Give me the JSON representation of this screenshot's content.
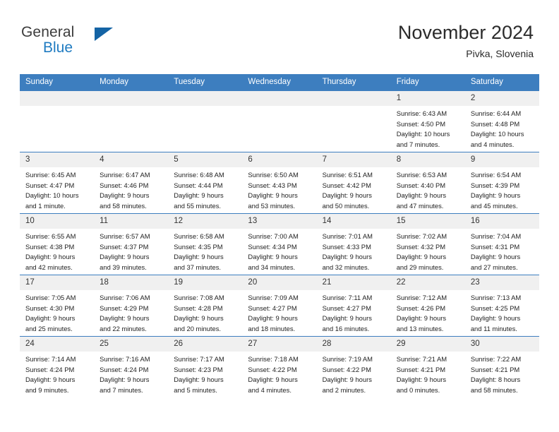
{
  "brand": {
    "name_part1": "General",
    "name_part2": "Blue",
    "triangle_color": "#1464a5",
    "blue_color": "#1f7bc1"
  },
  "header": {
    "title": "November 2024",
    "subtitle": "Pivka, Slovenia",
    "header_bg": "#3d7ebf",
    "header_text": "#ffffff",
    "daynum_bg": "#f0f0f0"
  },
  "weekday_headers": [
    "Sunday",
    "Monday",
    "Tuesday",
    "Wednesday",
    "Thursday",
    "Friday",
    "Saturday"
  ],
  "weeks": [
    [
      {
        "day": "",
        "sunrise": "",
        "sunset": "",
        "daylight1": "",
        "daylight2": ""
      },
      {
        "day": "",
        "sunrise": "",
        "sunset": "",
        "daylight1": "",
        "daylight2": ""
      },
      {
        "day": "",
        "sunrise": "",
        "sunset": "",
        "daylight1": "",
        "daylight2": ""
      },
      {
        "day": "",
        "sunrise": "",
        "sunset": "",
        "daylight1": "",
        "daylight2": ""
      },
      {
        "day": "",
        "sunrise": "",
        "sunset": "",
        "daylight1": "",
        "daylight2": ""
      },
      {
        "day": "1",
        "sunrise": "Sunrise: 6:43 AM",
        "sunset": "Sunset: 4:50 PM",
        "daylight1": "Daylight: 10 hours",
        "daylight2": "and 7 minutes."
      },
      {
        "day": "2",
        "sunrise": "Sunrise: 6:44 AM",
        "sunset": "Sunset: 4:48 PM",
        "daylight1": "Daylight: 10 hours",
        "daylight2": "and 4 minutes."
      }
    ],
    [
      {
        "day": "3",
        "sunrise": "Sunrise: 6:45 AM",
        "sunset": "Sunset: 4:47 PM",
        "daylight1": "Daylight: 10 hours",
        "daylight2": "and 1 minute."
      },
      {
        "day": "4",
        "sunrise": "Sunrise: 6:47 AM",
        "sunset": "Sunset: 4:46 PM",
        "daylight1": "Daylight: 9 hours",
        "daylight2": "and 58 minutes."
      },
      {
        "day": "5",
        "sunrise": "Sunrise: 6:48 AM",
        "sunset": "Sunset: 4:44 PM",
        "daylight1": "Daylight: 9 hours",
        "daylight2": "and 55 minutes."
      },
      {
        "day": "6",
        "sunrise": "Sunrise: 6:50 AM",
        "sunset": "Sunset: 4:43 PM",
        "daylight1": "Daylight: 9 hours",
        "daylight2": "and 53 minutes."
      },
      {
        "day": "7",
        "sunrise": "Sunrise: 6:51 AM",
        "sunset": "Sunset: 4:42 PM",
        "daylight1": "Daylight: 9 hours",
        "daylight2": "and 50 minutes."
      },
      {
        "day": "8",
        "sunrise": "Sunrise: 6:53 AM",
        "sunset": "Sunset: 4:40 PM",
        "daylight1": "Daylight: 9 hours",
        "daylight2": "and 47 minutes."
      },
      {
        "day": "9",
        "sunrise": "Sunrise: 6:54 AM",
        "sunset": "Sunset: 4:39 PM",
        "daylight1": "Daylight: 9 hours",
        "daylight2": "and 45 minutes."
      }
    ],
    [
      {
        "day": "10",
        "sunrise": "Sunrise: 6:55 AM",
        "sunset": "Sunset: 4:38 PM",
        "daylight1": "Daylight: 9 hours",
        "daylight2": "and 42 minutes."
      },
      {
        "day": "11",
        "sunrise": "Sunrise: 6:57 AM",
        "sunset": "Sunset: 4:37 PM",
        "daylight1": "Daylight: 9 hours",
        "daylight2": "and 39 minutes."
      },
      {
        "day": "12",
        "sunrise": "Sunrise: 6:58 AM",
        "sunset": "Sunset: 4:35 PM",
        "daylight1": "Daylight: 9 hours",
        "daylight2": "and 37 minutes."
      },
      {
        "day": "13",
        "sunrise": "Sunrise: 7:00 AM",
        "sunset": "Sunset: 4:34 PM",
        "daylight1": "Daylight: 9 hours",
        "daylight2": "and 34 minutes."
      },
      {
        "day": "14",
        "sunrise": "Sunrise: 7:01 AM",
        "sunset": "Sunset: 4:33 PM",
        "daylight1": "Daylight: 9 hours",
        "daylight2": "and 32 minutes."
      },
      {
        "day": "15",
        "sunrise": "Sunrise: 7:02 AM",
        "sunset": "Sunset: 4:32 PM",
        "daylight1": "Daylight: 9 hours",
        "daylight2": "and 29 minutes."
      },
      {
        "day": "16",
        "sunrise": "Sunrise: 7:04 AM",
        "sunset": "Sunset: 4:31 PM",
        "daylight1": "Daylight: 9 hours",
        "daylight2": "and 27 minutes."
      }
    ],
    [
      {
        "day": "17",
        "sunrise": "Sunrise: 7:05 AM",
        "sunset": "Sunset: 4:30 PM",
        "daylight1": "Daylight: 9 hours",
        "daylight2": "and 25 minutes."
      },
      {
        "day": "18",
        "sunrise": "Sunrise: 7:06 AM",
        "sunset": "Sunset: 4:29 PM",
        "daylight1": "Daylight: 9 hours",
        "daylight2": "and 22 minutes."
      },
      {
        "day": "19",
        "sunrise": "Sunrise: 7:08 AM",
        "sunset": "Sunset: 4:28 PM",
        "daylight1": "Daylight: 9 hours",
        "daylight2": "and 20 minutes."
      },
      {
        "day": "20",
        "sunrise": "Sunrise: 7:09 AM",
        "sunset": "Sunset: 4:27 PM",
        "daylight1": "Daylight: 9 hours",
        "daylight2": "and 18 minutes."
      },
      {
        "day": "21",
        "sunrise": "Sunrise: 7:11 AM",
        "sunset": "Sunset: 4:27 PM",
        "daylight1": "Daylight: 9 hours",
        "daylight2": "and 16 minutes."
      },
      {
        "day": "22",
        "sunrise": "Sunrise: 7:12 AM",
        "sunset": "Sunset: 4:26 PM",
        "daylight1": "Daylight: 9 hours",
        "daylight2": "and 13 minutes."
      },
      {
        "day": "23",
        "sunrise": "Sunrise: 7:13 AM",
        "sunset": "Sunset: 4:25 PM",
        "daylight1": "Daylight: 9 hours",
        "daylight2": "and 11 minutes."
      }
    ],
    [
      {
        "day": "24",
        "sunrise": "Sunrise: 7:14 AM",
        "sunset": "Sunset: 4:24 PM",
        "daylight1": "Daylight: 9 hours",
        "daylight2": "and 9 minutes."
      },
      {
        "day": "25",
        "sunrise": "Sunrise: 7:16 AM",
        "sunset": "Sunset: 4:24 PM",
        "daylight1": "Daylight: 9 hours",
        "daylight2": "and 7 minutes."
      },
      {
        "day": "26",
        "sunrise": "Sunrise: 7:17 AM",
        "sunset": "Sunset: 4:23 PM",
        "daylight1": "Daylight: 9 hours",
        "daylight2": "and 5 minutes."
      },
      {
        "day": "27",
        "sunrise": "Sunrise: 7:18 AM",
        "sunset": "Sunset: 4:22 PM",
        "daylight1": "Daylight: 9 hours",
        "daylight2": "and 4 minutes."
      },
      {
        "day": "28",
        "sunrise": "Sunrise: 7:19 AM",
        "sunset": "Sunset: 4:22 PM",
        "daylight1": "Daylight: 9 hours",
        "daylight2": "and 2 minutes."
      },
      {
        "day": "29",
        "sunrise": "Sunrise: 7:21 AM",
        "sunset": "Sunset: 4:21 PM",
        "daylight1": "Daylight: 9 hours",
        "daylight2": "and 0 minutes."
      },
      {
        "day": "30",
        "sunrise": "Sunrise: 7:22 AM",
        "sunset": "Sunset: 4:21 PM",
        "daylight1": "Daylight: 8 hours",
        "daylight2": "and 58 minutes."
      }
    ]
  ]
}
